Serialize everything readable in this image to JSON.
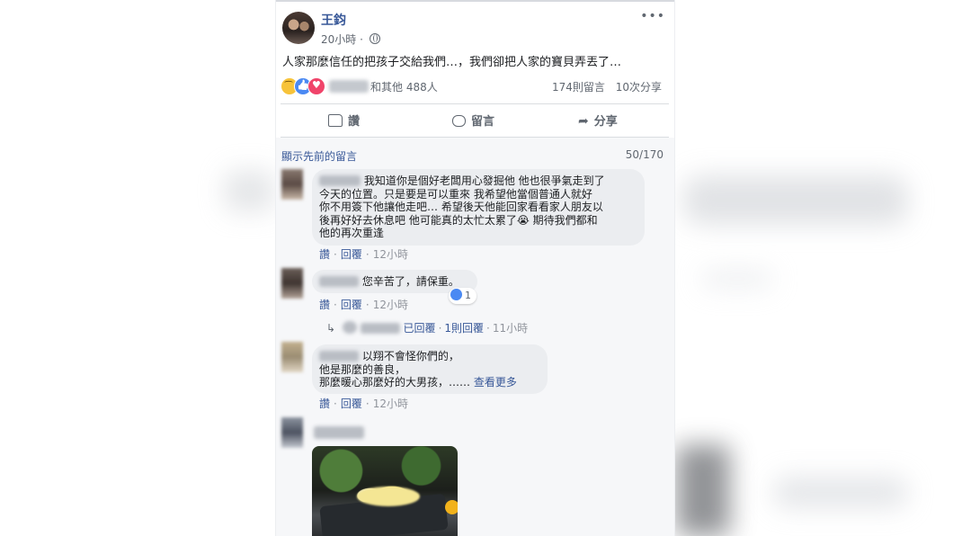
{
  "post": {
    "author": "王鈞",
    "time": "20小時",
    "text": "人家那麼信任的把孩子交給我們…，我們卻把人家的寶貝弄丟了…",
    "more_label": "•••",
    "reactions": {
      "others_text": "和其他 488人",
      "comments_count": "174則留言",
      "shares_count": "10次分享"
    },
    "actions": {
      "like": "讚",
      "comment": "留言",
      "share": "分享"
    }
  },
  "comments_section": {
    "view_previous": "顯示先前的留言",
    "count": "50/170",
    "comments": [
      {
        "lines": [
          "我知道你是個好老闆用心發掘他 他也很爭氣走到了",
          "今天的位置。只是要是可以重來 我希望他當個普通人就好",
          "你不用簽下他讓他走吧… 希望後天他能回家看看家人朋友以",
          "後再好好去休息吧 他可能真的太忙太累了😭 期待我們都和",
          "他的再次重逢"
        ],
        "like": "讚",
        "reply": "回覆",
        "time": "12小時"
      },
      {
        "lines": [
          "您辛苦了，請保重。"
        ],
        "like": "讚",
        "reply": "回覆",
        "time": "12小時",
        "reaction_count": "1",
        "reply_summary": {
          "replied": "已回覆",
          "count": "1則回覆",
          "time": "11小時"
        }
      },
      {
        "lines": [
          "以翔不會怪你們的，",
          "他是那麼的善良，",
          "那麼暖心那麼好的大男孩，"
        ],
        "ellipsis": "……",
        "see_more": "查看更多",
        "like": "讚",
        "reply": "回覆",
        "time": "12小時"
      }
    ]
  }
}
